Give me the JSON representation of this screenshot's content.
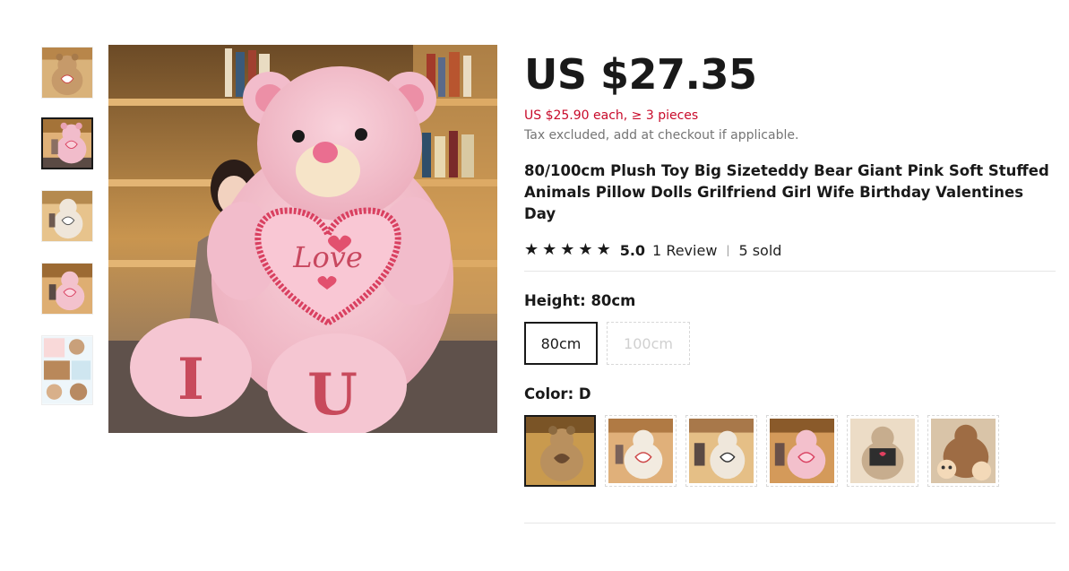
{
  "product": {
    "price": "US $27.35",
    "bulk_price": "US $25.90 each, ≥ 3 pieces",
    "tax_note": "Tax excluded, add at checkout if applicable.",
    "title": "80/100cm Plush Toy Big Sizeteddy Bear Giant Pink Soft Stuffed Animals Pillow Dolls Grilfriend Girl Wife Birthday Valentines Day",
    "rating": "5.0",
    "reviews": "1 Review",
    "separator": "|",
    "sold": "5 sold",
    "star_count": 5
  },
  "height": {
    "label": "Height: 80cm",
    "options": [
      {
        "label": "80cm",
        "state": "selected"
      },
      {
        "label": "100cm",
        "state": "disabled"
      }
    ]
  },
  "color": {
    "label": "Color: D",
    "swatches": [
      {
        "name": "brown bear",
        "state": "selected"
      },
      {
        "name": "white bear",
        "state": "normal"
      },
      {
        "name": "white bear with girl",
        "state": "normal"
      },
      {
        "name": "pink bear",
        "state": "normal"
      },
      {
        "name": "grey bear I love you",
        "state": "normal"
      },
      {
        "name": "brown bear emoji",
        "state": "normal"
      }
    ]
  },
  "gallery": {
    "selected_index": 1,
    "main_image": {
      "heart_text": "Love",
      "left_paw_letter": "I",
      "right_paw_letter": "U"
    }
  },
  "colors": {
    "text": "#191919",
    "bulk_price": "#c80a2a",
    "muted": "#757575",
    "bear_pink": "#f4bcc8",
    "heart_red": "#d94060"
  }
}
